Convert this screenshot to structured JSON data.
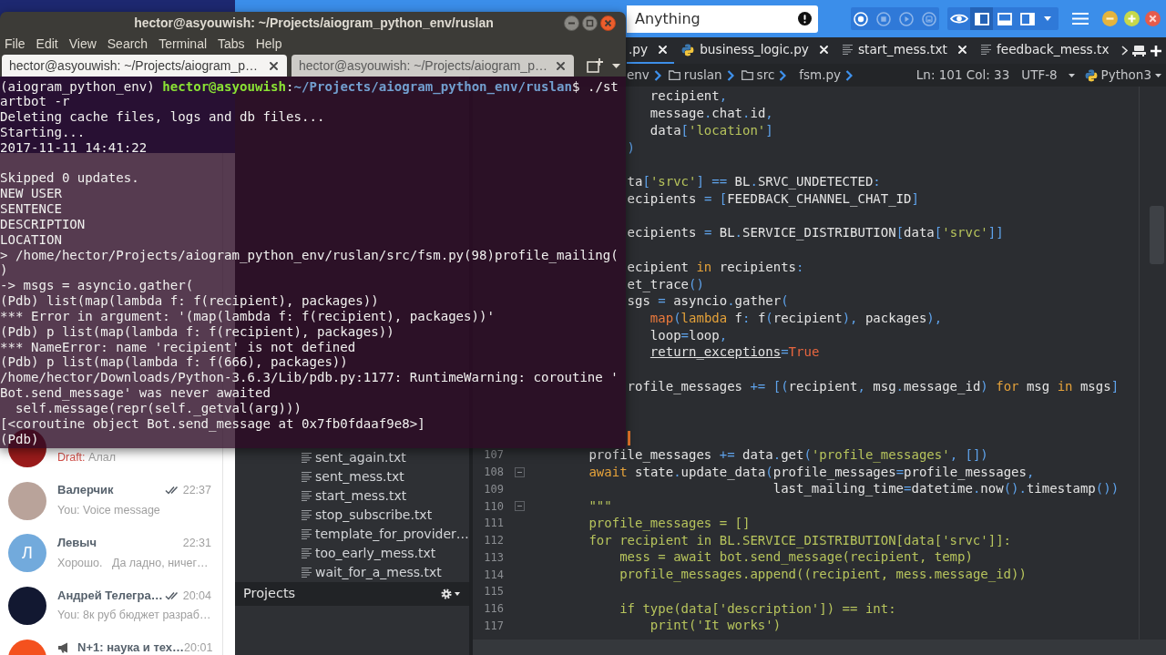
{
  "terminal": {
    "title": "hector@asyouwish: ~/Projects/aiogram_python_env/ruslan",
    "menu": [
      "File",
      "Edit",
      "View",
      "Search",
      "Terminal",
      "Tabs",
      "Help"
    ],
    "tabs": [
      {
        "label": "hector@asyouwish: ~/Projects/aiogram_p…",
        "selected": true
      },
      {
        "label": "hector@asyouwish: ~/Projects/aiogram_p…",
        "selected": false
      }
    ],
    "lines": [
      {
        "kind": "prompt",
        "venv": "(aiogram_python_env)",
        "user": "hector@asyouwish",
        "separator": ":",
        "path": "~/Projects/aiogram_python_env/ruslan",
        "command": "$ ./st"
      },
      {
        "kind": "output",
        "text": "artbot -r"
      },
      {
        "kind": "output",
        "text": "Deleting cache files, logs and db files..."
      },
      {
        "kind": "output",
        "text": "Starting..."
      },
      {
        "kind": "output",
        "text": "2017-11-11 14:41:22"
      },
      {
        "kind": "blank"
      },
      {
        "kind": "output",
        "text": "Skipped 0 updates."
      },
      {
        "kind": "output",
        "text": "NEW USER"
      },
      {
        "kind": "output",
        "text": "SENTENCE"
      },
      {
        "kind": "output",
        "text": "DESCRIPTION"
      },
      {
        "kind": "output",
        "text": "LOCATION"
      },
      {
        "kind": "output",
        "text": "> /home/hector/Projects/aiogram_python_env/ruslan/src/fsm.py(98)profile_mailing("
      },
      {
        "kind": "output",
        "text": ")"
      },
      {
        "kind": "output",
        "text": "-> msgs = asyncio.gather("
      },
      {
        "kind": "output",
        "text": "(Pdb) list(map(lambda f: f(recipient), packages))"
      },
      {
        "kind": "output",
        "text": "*** Error in argument: '(map(lambda f: f(recipient), packages))'"
      },
      {
        "kind": "output",
        "text": "(Pdb) p list(map(lambda f: f(recipient), packages))"
      },
      {
        "kind": "output",
        "text": "*** NameError: name 'recipient' is not defined"
      },
      {
        "kind": "output",
        "text": "(Pdb) p list(map(lambda f: f(666), packages))"
      },
      {
        "kind": "output",
        "text": "/home/hector/Downloads/Python-3.6.3/Lib/pdb.py:1177: RuntimeWarning: coroutine '"
      },
      {
        "kind": "output",
        "text": "Bot.send_message' was never awaited"
      },
      {
        "kind": "output",
        "text": "  self.message(repr(self._getval(arg)))"
      },
      {
        "kind": "output",
        "text": "[<coroutine object Bot.send_message at 0x7fb0fdaaf9e8>]"
      },
      {
        "kind": "output",
        "text": "(Pdb)"
      }
    ]
  },
  "telegram": {
    "chats": [
      {
        "kind": "chat",
        "avatar": {
          "color": "#9a1b1b"
        },
        "draft": "Draft:",
        "preview": "Алал",
        "read": false
      },
      {
        "kind": "chat",
        "avatar": {
          "color": "#b9a39a"
        },
        "name": "Валерчик",
        "time": "22:37",
        "read": true,
        "preview": "You: Voice message"
      },
      {
        "kind": "chat",
        "avatar": {
          "color": "#72aadc",
          "letter": "Л"
        },
        "name": "Левыч",
        "time": "22:31",
        "read": false,
        "preview": "Хорошо.   Да ладно, ничег…"
      },
      {
        "kind": "chat",
        "avatar": {
          "color": "#121831"
        },
        "name": "Андрей Телегра…",
        "time": "20:04",
        "read": true,
        "preview": "You: 8к руб бюджет разраб…"
      },
      {
        "kind": "channel",
        "avatar": {
          "color": "#f4511e"
        },
        "name": "N+1: наука и тех…",
        "time": "20:01",
        "read": false
      }
    ]
  },
  "komodo": {
    "search": {
      "placeholder": "Anything"
    },
    "macro_buttons": [
      {
        "kind": "record",
        "disabled": false
      },
      {
        "kind": "stop",
        "disabled": true
      },
      {
        "kind": "play",
        "disabled": true
      },
      {
        "kind": "save",
        "disabled": true
      }
    ],
    "view_buttons": [
      {
        "kind": "preview",
        "selected": false
      },
      {
        "kind": "left-pane",
        "selected": true
      },
      {
        "kind": "bottom-pane",
        "selected": false
      },
      {
        "kind": "right-pane",
        "selected": false
      }
    ],
    "tabs": [
      {
        "label": ".py",
        "selected": true,
        "closable": true
      },
      {
        "label": "business_logic.py",
        "kind": "python",
        "selected": false,
        "closable": true
      },
      {
        "label": "start_mess.txt",
        "kind": "text",
        "selected": false,
        "closable": true
      },
      {
        "label": "feedback_mess.tx",
        "kind": "text",
        "selected": false,
        "closable": false
      }
    ],
    "breadcrumb": [
      {
        "label": "env"
      },
      {
        "label": "ruslan",
        "kind": "folder"
      },
      {
        "label": "src",
        "kind": "folder"
      },
      {
        "label": "fsm.py"
      }
    ],
    "status": {
      "position": "Ln: 101 Col: 33",
      "encoding": "UTF-8",
      "language": "Python3"
    },
    "file_tree": {
      "files": [
        "sent_again.txt",
        "sent_mess.txt",
        "start_mess.txt",
        "stop_subscribe.txt",
        "template_for_provider…",
        "too_early_mess.txt",
        "wait_for_a_mess.txt"
      ],
      "panel_title": "Projects"
    },
    "editor": {
      "lines": [
        {
          "cursor": false,
          "segments": [
            {
              "text": "                recipient"
            },
            {
              "text": ",",
              "kind": "punct"
            }
          ]
        },
        {
          "cursor": false,
          "segments": [
            {
              "text": "                message"
            },
            {
              "text": ".",
              "kind": "punct"
            },
            {
              "text": "chat"
            },
            {
              "text": ".",
              "kind": "punct"
            },
            {
              "text": "id"
            },
            {
              "text": ",",
              "kind": "punct"
            }
          ]
        },
        {
          "cursor": false,
          "segments": [
            {
              "text": "                data"
            },
            {
              "text": "[",
              "kind": "punct"
            },
            {
              "text": "'location'",
              "kind": "string"
            },
            {
              "text": "]",
              "kind": "punct"
            }
          ]
        },
        {
          "cursor": false,
          "segments": [
            {
              "text": "             )",
              "kind": "punct"
            }
          ]
        },
        {
          "cursor": false
        },
        {
          "cursor": false,
          "segments": [
            {
              "text": "             ta"
            },
            {
              "text": "[",
              "kind": "punct"
            },
            {
              "text": "'srvc'",
              "kind": "string"
            },
            {
              "text": "] ==",
              "kind": "punct"
            },
            {
              "text": " BL"
            },
            {
              "text": ".",
              "kind": "punct"
            },
            {
              "text": "SRVC_UNDETECTED"
            },
            {
              "text": ":",
              "kind": "punct"
            }
          ]
        },
        {
          "cursor": false,
          "segments": [
            {
              "text": "             ecipients "
            },
            {
              "text": "= [",
              "kind": "punct"
            },
            {
              "text": "FEEDBACK_CHANNEL_CHAT_ID"
            },
            {
              "text": "]",
              "kind": "punct"
            }
          ]
        },
        {
          "cursor": false
        },
        {
          "cursor": false,
          "segments": [
            {
              "text": "             ecipients "
            },
            {
              "text": "=",
              "kind": "punct"
            },
            {
              "text": " BL"
            },
            {
              "text": ".",
              "kind": "punct"
            },
            {
              "text": "SERVICE_DISTRIBUTION"
            },
            {
              "text": "[",
              "kind": "punct"
            },
            {
              "text": "data"
            },
            {
              "text": "[",
              "kind": "punct"
            },
            {
              "text": "'srvc'",
              "kind": "string"
            },
            {
              "text": "]]",
              "kind": "punct"
            }
          ]
        },
        {
          "cursor": false
        },
        {
          "cursor": false,
          "segments": [
            {
              "text": "             ecipient "
            },
            {
              "text": "in",
              "kind": "keyword"
            },
            {
              "text": " recipients"
            },
            {
              "text": ":",
              "kind": "punct"
            }
          ]
        },
        {
          "cursor": false,
          "segments": [
            {
              "text": "             et_trace"
            },
            {
              "text": "()",
              "kind": "punct"
            }
          ]
        },
        {
          "cursor": false,
          "segments": [
            {
              "text": "             sgs "
            },
            {
              "text": "=",
              "kind": "punct"
            },
            {
              "text": " asyncio"
            },
            {
              "text": ".",
              "kind": "punct"
            },
            {
              "text": "gather"
            },
            {
              "text": "(",
              "kind": "punct"
            }
          ]
        },
        {
          "cursor": false,
          "segments": [
            {
              "text": "                map",
              "kind": "builtin"
            },
            {
              "text": "(",
              "kind": "punct"
            },
            {
              "text": "lambda",
              "kind": "keyword"
            },
            {
              "text": " f"
            },
            {
              "text": ":",
              "kind": "punct"
            },
            {
              "text": " f"
            },
            {
              "text": "(",
              "kind": "punct"
            },
            {
              "text": "recipient"
            },
            {
              "text": "),",
              "kind": "punct"
            },
            {
              "text": " packages"
            },
            {
              "text": "),",
              "kind": "punct"
            }
          ]
        },
        {
          "cursor": false,
          "segments": [
            {
              "text": "                loop"
            },
            {
              "text": "=",
              "kind": "punct"
            },
            {
              "text": "loop"
            },
            {
              "text": ",",
              "kind": "punct"
            }
          ]
        },
        {
          "cursor": false,
          "segments": [
            {
              "text": "                return_exceptions",
              "kind": "underlined"
            },
            {
              "text": "=",
              "kind": "punct"
            },
            {
              "text": "True",
              "kind": "constant"
            }
          ]
        },
        {
          "cursor": false
        },
        {
          "cursor": false,
          "segments": [
            {
              "text": "             rofile_messages "
            },
            {
              "text": "+= [(",
              "kind": "punct"
            },
            {
              "text": "recipient"
            },
            {
              "text": ",",
              "kind": "punct"
            },
            {
              "text": " msg"
            },
            {
              "text": ".",
              "kind": "punct"
            },
            {
              "text": "message_id"
            },
            {
              "text": ") ",
              "kind": "punct"
            },
            {
              "text": "for",
              "kind": "keyword"
            },
            {
              "text": " msg "
            },
            {
              "text": "in",
              "kind": "keyword"
            },
            {
              "text": " msgs"
            },
            {
              "text": "]",
              "kind": "punct"
            }
          ]
        },
        {
          "cursor": false
        },
        {
          "cursor": false
        },
        {
          "cursor": true
        },
        {
          "number": "107",
          "fold": false,
          "cursor": false,
          "segments": [
            {
              "text": "        profile_messages "
            },
            {
              "text": "+=",
              "kind": "punct"
            },
            {
              "text": " data"
            },
            {
              "text": ".",
              "kind": "punct"
            },
            {
              "text": "get"
            },
            {
              "text": "(",
              "kind": "punct"
            },
            {
              "text": "'profile_messages'",
              "kind": "string"
            },
            {
              "text": ", [])",
              "kind": "punct"
            }
          ]
        },
        {
          "number": "108",
          "fold": true,
          "cursor": false,
          "segments": [
            {
              "text": "        await",
              "kind": "keyword"
            },
            {
              "text": " state"
            },
            {
              "text": ".",
              "kind": "punct"
            },
            {
              "text": "update_data"
            },
            {
              "text": "(",
              "kind": "punct"
            },
            {
              "text": "profile_messages"
            },
            {
              "text": "=",
              "kind": "punct"
            },
            {
              "text": "profile_messages"
            },
            {
              "text": ",",
              "kind": "punct"
            }
          ]
        },
        {
          "number": "109",
          "fold": false,
          "cursor": false,
          "segments": [
            {
              "text": "                                last_mailing_time"
            },
            {
              "text": "=",
              "kind": "punct"
            },
            {
              "text": "datetime"
            },
            {
              "text": ".",
              "kind": "punct"
            },
            {
              "text": "now"
            },
            {
              "text": "().",
              "kind": "punct"
            },
            {
              "text": "timestamp"
            },
            {
              "text": "())",
              "kind": "punct"
            }
          ]
        },
        {
          "number": "110",
          "fold": true,
          "cursor": false,
          "segments": [
            {
              "text": "        \"\"\"",
              "kind": "string"
            }
          ]
        },
        {
          "number": "111",
          "fold": false,
          "cursor": false,
          "segments": [
            {
              "text": "        profile_messages = []",
              "kind": "string"
            }
          ]
        },
        {
          "number": "112",
          "fold": false,
          "cursor": false,
          "segments": [
            {
              "text": "        for recipient in BL.SERVICE_DISTRIBUTION[data['srvc']]:",
              "kind": "string"
            }
          ]
        },
        {
          "number": "113",
          "fold": false,
          "cursor": false,
          "segments": [
            {
              "text": "            mess = await bot.send_message(recipient, temp)",
              "kind": "string"
            }
          ]
        },
        {
          "number": "114",
          "fold": false,
          "cursor": false,
          "segments": [
            {
              "text": "            profile_messages.append((recipient, mess.message_id))",
              "kind": "string"
            }
          ]
        },
        {
          "number": "115",
          "fold": false,
          "cursor": false
        },
        {
          "number": "116",
          "fold": false,
          "cursor": false,
          "segments": [
            {
              "text": "            if type(data['description']) == int:",
              "kind": "string"
            }
          ]
        },
        {
          "number": "117",
          "fold": false,
          "cursor": false,
          "segments": [
            {
              "text": "                print('It works')",
              "kind": "string"
            }
          ]
        }
      ]
    }
  }
}
